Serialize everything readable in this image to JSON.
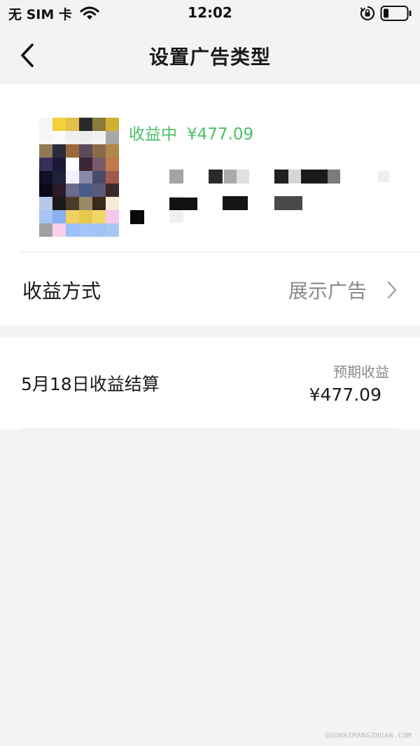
{
  "status_bar": {
    "carrier": "无 SIM 卡",
    "time": "12:02",
    "icons": [
      "wifi-icon",
      "lock-rotation-icon",
      "battery-icon"
    ]
  },
  "nav": {
    "title": "设置广告类型",
    "back_icon": "chevron-left-icon"
  },
  "ad_card": {
    "status_label": "收益中",
    "status_amount": "¥477.09",
    "status_color": "#4cbf6a",
    "method_label": "收益方式",
    "method_value": "展示广告",
    "method_icon": "chevron-right-icon"
  },
  "settlement": {
    "label": "5月18日收益结算",
    "expected_label": "预期收益",
    "expected_value": "¥477.09"
  },
  "watermark": "GUOWAIMANGZHUAN.COM"
}
